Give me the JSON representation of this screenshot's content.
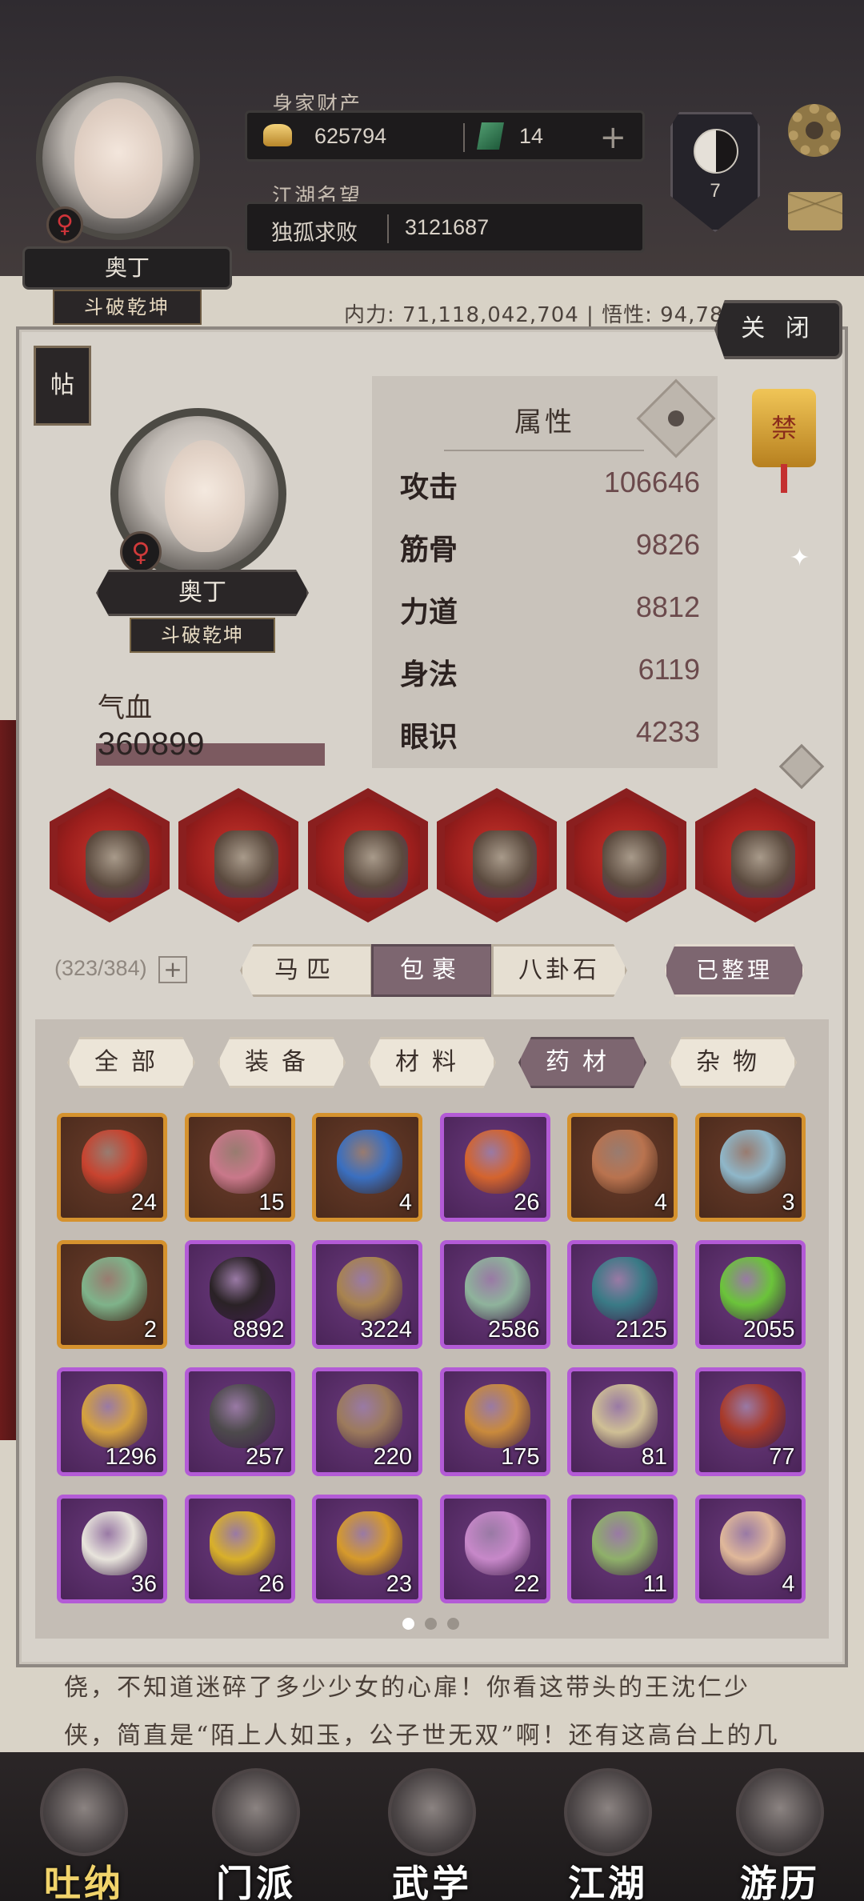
{
  "header": {
    "avatar_gender": "♀",
    "player_name": "奥丁",
    "player_title": "斗破乾坤",
    "assets_label": "身家财产",
    "gold": "625794",
    "jade": "14",
    "reputation_label": "江湖名望",
    "reputation_rank": "独孤求败",
    "reputation_value": "3121687",
    "badge_number": "7",
    "stat_line": "内力: 71,118,042,704 | 悟性: 94,78"
  },
  "panel": {
    "close_label": "关 闭",
    "tie_label": "帖",
    "gender": "♀",
    "name": "奥丁",
    "title": "斗破乾坤",
    "hp_label": "气血",
    "hp_value": "360899",
    "attributes_title": "属性",
    "ban_label": "禁",
    "attributes": [
      {
        "name": "攻击",
        "value": "106646"
      },
      {
        "name": "筋骨",
        "value": "9826"
      },
      {
        "name": "力道",
        "value": "8812"
      },
      {
        "name": "身法",
        "value": "6119"
      },
      {
        "name": "眼识",
        "value": "4233"
      }
    ],
    "equipment": [
      {
        "icon": "spear-icon"
      },
      {
        "icon": "armor-icon"
      },
      {
        "icon": "ring-icon"
      },
      {
        "icon": "boots-icon"
      },
      {
        "icon": "amulet-icon"
      },
      {
        "icon": "mount-icon"
      }
    ],
    "capacity": "(323/384)",
    "capacity_plus": "+",
    "tabs": [
      "马匹",
      "包裹",
      "八卦石"
    ],
    "active_tab": 1,
    "sorted_label": "已整理",
    "filters": [
      "全部",
      "装备",
      "材料",
      "药材",
      "杂物"
    ],
    "active_filter": 3,
    "items": [
      {
        "count": "24",
        "rarity": "orange",
        "icon": "red-pill-icon",
        "color": "#c8432f"
      },
      {
        "count": "15",
        "rarity": "orange",
        "icon": "pink-pills-icon",
        "color": "#c9788a"
      },
      {
        "count": "4",
        "rarity": "orange",
        "icon": "blue-pill-icon",
        "color": "#3a6fc0"
      },
      {
        "count": "26",
        "rarity": "purple",
        "icon": "fire-pill-icon",
        "color": "#d4642e"
      },
      {
        "count": "4",
        "rarity": "orange",
        "icon": "orb-icon",
        "color": "#b9734f"
      },
      {
        "count": "3",
        "rarity": "orange",
        "icon": "bowl-icon",
        "color": "#8fb7c9"
      },
      {
        "count": "2",
        "rarity": "orange",
        "icon": "lotus-icon",
        "color": "#7fb38a"
      },
      {
        "count": "8892",
        "rarity": "purple",
        "icon": "spider-icon",
        "color": "#2a2226"
      },
      {
        "count": "3224",
        "rarity": "purple",
        "icon": "herb-pile-icon",
        "color": "#a8834f"
      },
      {
        "count": "2586",
        "rarity": "purple",
        "icon": "vial-icon",
        "color": "#8fb39c"
      },
      {
        "count": "2125",
        "rarity": "purple",
        "icon": "vine-icon",
        "color": "#3a7a86"
      },
      {
        "count": "2055",
        "rarity": "purple",
        "icon": "green-bowl-icon",
        "color": "#6bc43a"
      },
      {
        "count": "1296",
        "rarity": "purple",
        "icon": "ginseng-icon",
        "color": "#d5a23e"
      },
      {
        "count": "257",
        "rarity": "purple",
        "icon": "rock-icon",
        "color": "#4d4a4c"
      },
      {
        "count": "220",
        "rarity": "purple",
        "icon": "root-icon",
        "color": "#9c7a5c"
      },
      {
        "count": "175",
        "rarity": "purple",
        "icon": "leaves-icon",
        "color": "#c98a3c"
      },
      {
        "count": "81",
        "rarity": "purple",
        "icon": "leaf-icon",
        "color": "#cfbf95"
      },
      {
        "count": "77",
        "rarity": "purple",
        "icon": "mushroom-icon",
        "color": "#a83a2a"
      },
      {
        "count": "36",
        "rarity": "purple",
        "icon": "white-flower-icon",
        "color": "#e8e4dc"
      },
      {
        "count": "26",
        "rarity": "purple",
        "icon": "yellow-flower-icon",
        "color": "#d9b02a"
      },
      {
        "count": "23",
        "rarity": "purple",
        "icon": "gourd-icon",
        "color": "#d69a2c"
      },
      {
        "count": "22",
        "rarity": "purple",
        "icon": "pink-flower-icon",
        "color": "#c788c9"
      },
      {
        "count": "11",
        "rarity": "purple",
        "icon": "cabbage-icon",
        "color": "#8fb06a"
      },
      {
        "count": "4",
        "rarity": "purple",
        "icon": "bone-icon",
        "color": "#e0b89a"
      }
    ]
  },
  "story_text": "侥，不知道迷碎了多少少女的心扉！你看这带头的王沈仁少侠，简直是“陌上人如玉，公子世无双”啊！还有这高台上的几位武林名",
  "nav": [
    {
      "label": "吐纳",
      "active": true
    },
    {
      "label": "门派",
      "active": false
    },
    {
      "label": "武学",
      "active": false
    },
    {
      "label": "江湖",
      "active": false
    },
    {
      "label": "游历",
      "active": false
    }
  ]
}
